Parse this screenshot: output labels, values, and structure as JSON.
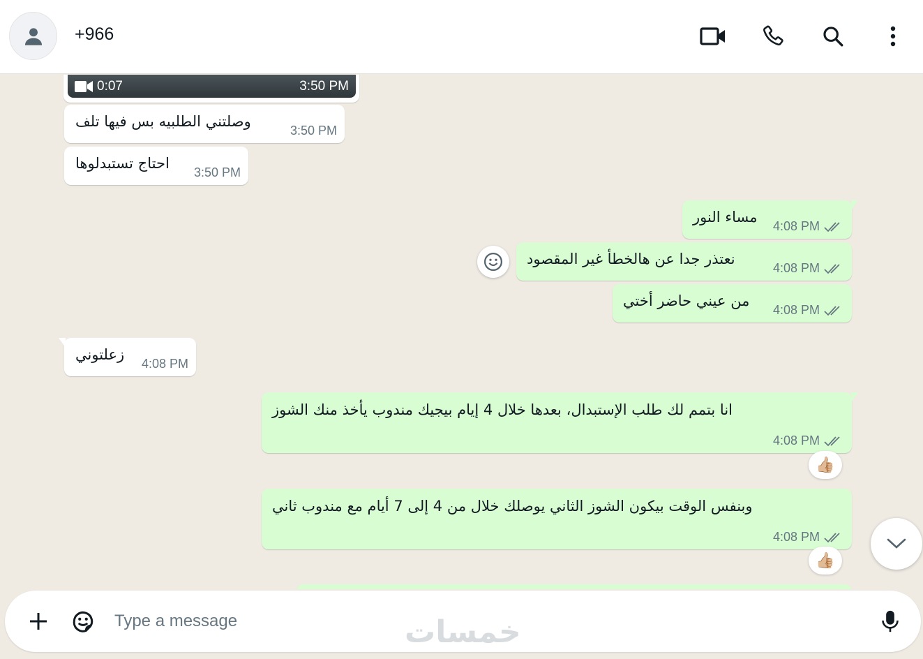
{
  "header": {
    "contact_name": "+966",
    "icons": [
      "video-call-icon",
      "voice-call-icon",
      "search-icon",
      "more-options-icon"
    ]
  },
  "video_message": {
    "duration": "0:07",
    "time": "3:50 PM"
  },
  "messages": [
    {
      "dir": "in",
      "text": "وصلتني الطلبيه بس فيها تلف",
      "time": "3:50 PM"
    },
    {
      "dir": "in",
      "text": "احتاج تستبدلوها",
      "time": "3:50 PM"
    },
    {
      "dir": "out",
      "text": "مساء النور",
      "time": "4:08 PM"
    },
    {
      "dir": "out",
      "text": "نعتذر جدا عن هالخطأ غير المقصود",
      "time": "4:08 PM"
    },
    {
      "dir": "out",
      "text": "من عيني حاضر أختي",
      "time": "4:08 PM"
    },
    {
      "dir": "in",
      "text": "زعلتوني",
      "time": "4:08 PM"
    },
    {
      "dir": "out",
      "text": "انا بتمم لك طلب الإستبدال، بعدها خلال 4 إيام بيجيك مندوب يأخذ منك الشوز",
      "time": "4:08 PM",
      "reaction": "👍🏼"
    },
    {
      "dir": "out",
      "text": "وبنفس الوقت بيكون الشوز الثاني يوصلك خلال من 4 إلى 7 أيام مع مندوب ثاني",
      "time": "4:08 PM",
      "reaction": "👍🏼"
    }
  ],
  "composer": {
    "placeholder": "Type a message"
  },
  "watermark": "خمسات",
  "colors": {
    "outgoing_bubble": "#d9fdd3",
    "incoming_bubble": "#ffffff",
    "chat_background": "#efeae2",
    "read_ticks": "#667781"
  }
}
